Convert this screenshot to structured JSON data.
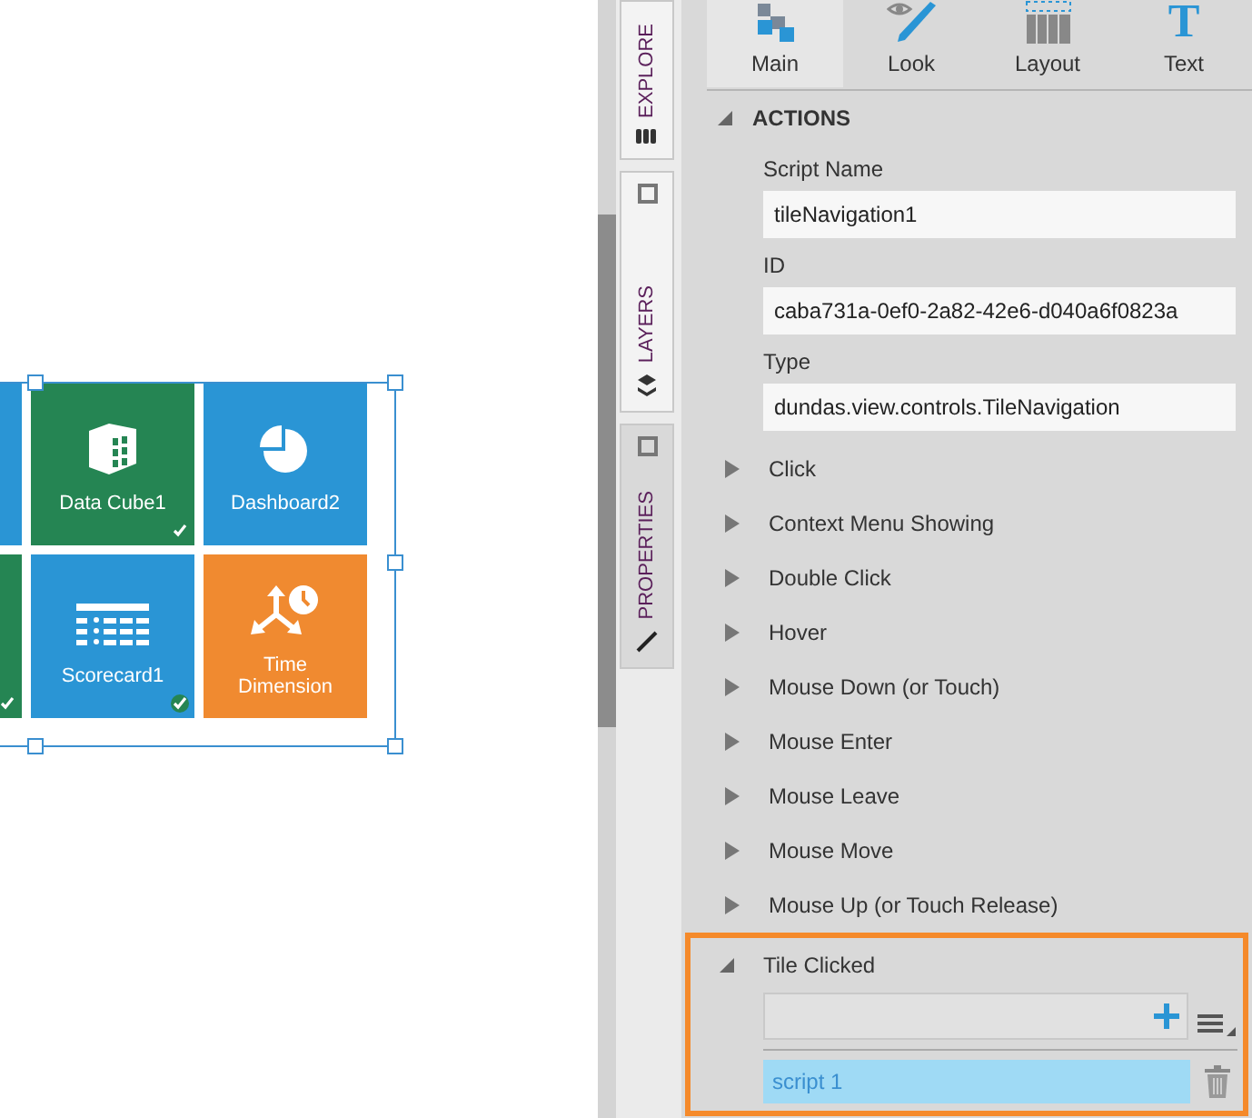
{
  "tiles": [
    {
      "color": "#2a95d5",
      "checked": false
    },
    {
      "label": "Data Cube1",
      "kind": "cube",
      "color": "#258553",
      "checked": true,
      "check_circled": false
    },
    {
      "label": "Dashboard2",
      "kind": "pie",
      "color": "#2a95d5",
      "checked": false
    },
    {
      "color": "#258553",
      "checked": true,
      "check_circled": false
    },
    {
      "label": "Scorecard1",
      "kind": "table",
      "color": "#2a95d5",
      "checked": true,
      "check_circled": true
    },
    {
      "label": "Time Dimension",
      "kind": "time",
      "color": "#f08a30",
      "checked": false
    }
  ],
  "side_tabs": [
    {
      "label": "EXPLORE",
      "selected": false,
      "kind": "explore"
    },
    {
      "label": "LAYERS",
      "selected": false,
      "kind": "layers"
    },
    {
      "label": "PROPERTIES",
      "selected": true,
      "kind": "properties"
    }
  ],
  "toolbar": [
    {
      "label": "Main",
      "kind": "main",
      "selected": true
    },
    {
      "label": "Look",
      "kind": "look",
      "selected": false
    },
    {
      "label": "Layout",
      "kind": "layout",
      "selected": false
    },
    {
      "label": "Text",
      "kind": "text",
      "icon_text": "T",
      "selected": false
    }
  ],
  "section": {
    "title": "ACTIONS",
    "expanded": true
  },
  "fields": [
    {
      "label": "Script Name",
      "value": "tileNavigation1"
    },
    {
      "label": "ID",
      "value": "caba731a-0ef0-2a82-42e6-d040a6f0823a"
    },
    {
      "label": "Type",
      "value": "dundas.view.controls.TileNavigation"
    }
  ],
  "events": [
    {
      "label": "Click",
      "expanded": false
    },
    {
      "label": "Context Menu Showing",
      "expanded": false
    },
    {
      "label": "Double Click",
      "expanded": false
    },
    {
      "label": "Hover",
      "expanded": false
    },
    {
      "label": "Mouse Down (or Touch)",
      "expanded": false
    },
    {
      "label": "Mouse Enter",
      "expanded": false
    },
    {
      "label": "Mouse Leave",
      "expanded": false
    },
    {
      "label": "Mouse Move",
      "expanded": false
    },
    {
      "label": "Mouse Up (or Touch Release)",
      "expanded": false
    },
    {
      "label": "Tile Clicked",
      "expanded": true,
      "highlighted": true,
      "scripts": [
        {
          "label": "script 1",
          "selected": true
        }
      ]
    }
  ]
}
